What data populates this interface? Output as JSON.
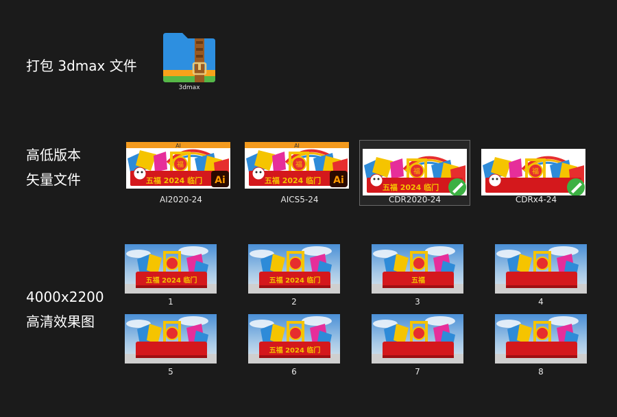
{
  "sections": {
    "package": {
      "label": "打包 3dmax 文件"
    },
    "vector": {
      "line1": "高低版本",
      "line2": "矢量文件"
    },
    "renders": {
      "line1": "4000x2200",
      "line2": "高清效果图"
    }
  },
  "zip_file": {
    "caption": "3dmax",
    "icon": "zip-folder-icon"
  },
  "vector_files": [
    {
      "caption": "AI2020-24",
      "top_tag": "AI",
      "badge": "Ai",
      "badge_icon": "adobe-illustrator-icon",
      "title": "五福 2024 临门"
    },
    {
      "caption": "AICS5-24",
      "top_tag": "AI",
      "badge": "Ai",
      "badge_icon": "adobe-illustrator-icon",
      "title": "五福 2024 临门"
    },
    {
      "caption": "CDR2020-24",
      "top_tag": "",
      "badge": "",
      "badge_icon": "coreldraw-icon",
      "title": "五福 2024 临门"
    },
    {
      "caption": "CDRx4-24",
      "top_tag": "",
      "badge": "",
      "badge_icon": "coreldraw-icon",
      "title": ""
    }
  ],
  "renders": [
    {
      "caption": "1",
      "title": "五福 2024 临门"
    },
    {
      "caption": "2",
      "title": "五福 2024 临门"
    },
    {
      "caption": "3",
      "title": "五福"
    },
    {
      "caption": "4",
      "title": ""
    },
    {
      "caption": "5",
      "title": ""
    },
    {
      "caption": "6",
      "title": "五福 2024 临门"
    },
    {
      "caption": "7",
      "title": ""
    },
    {
      "caption": "8",
      "title": ""
    }
  ],
  "colors": {
    "background": "#1b1b1b",
    "ai_badge_bg": "#2b0a00",
    "ai_badge_text": "#ff9a00",
    "cdr_badge": "#3cb043",
    "float_red": "#d4181c",
    "gold": "#f2c200"
  }
}
